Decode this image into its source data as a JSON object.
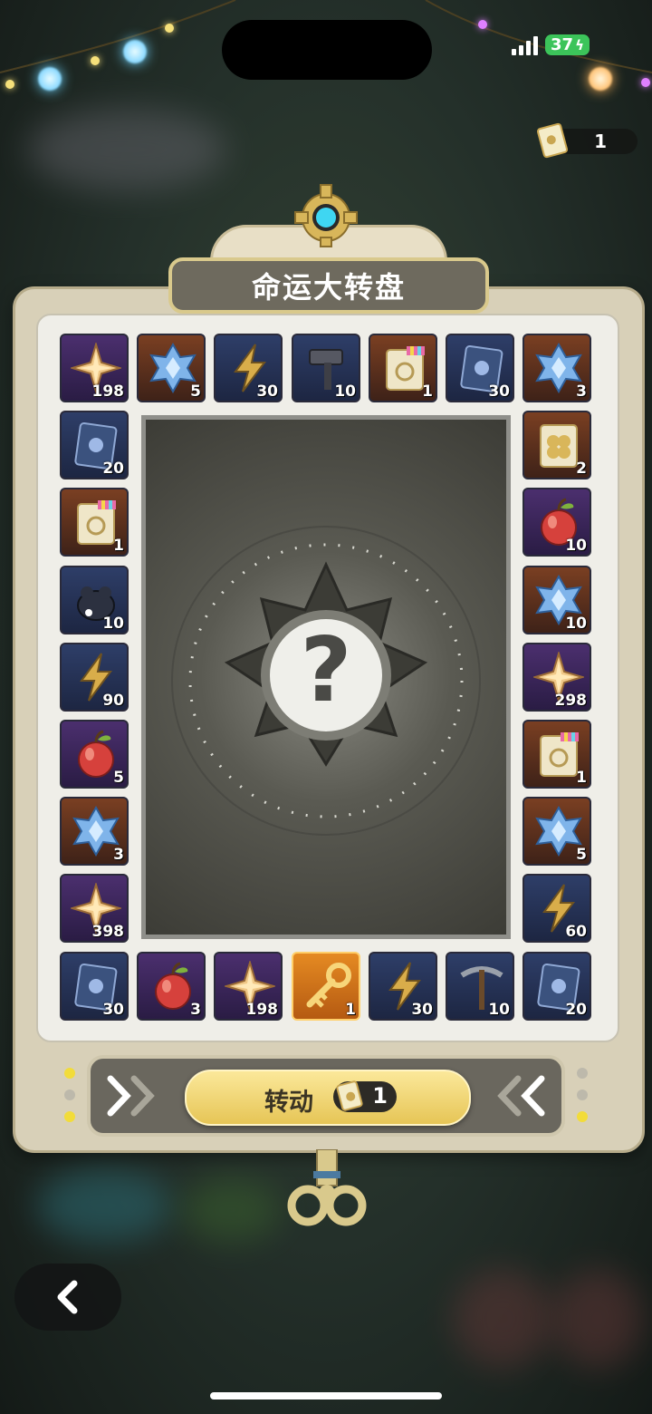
{
  "status_bar": {
    "battery": "37"
  },
  "ticket_balance": "1",
  "title": "命运大转盘",
  "center": {
    "mystery_symbol": "?"
  },
  "spin": {
    "label": "转动",
    "cost": "1"
  },
  "rewards": {
    "top": [
      {
        "item": "star-crystal-icon",
        "qty": "198",
        "rarity": "purple"
      },
      {
        "item": "blue-gem-icon",
        "qty": "5",
        "rarity": "orange"
      },
      {
        "item": "lightning-icon",
        "qty": "30",
        "rarity": "blue"
      },
      {
        "item": "hammer-icon",
        "qty": "10",
        "rarity": "blue"
      },
      {
        "item": "rainbow-ticket-icon",
        "qty": "1",
        "rarity": "orange"
      },
      {
        "item": "blue-card-icon",
        "qty": "30",
        "rarity": "blue"
      },
      {
        "item": "blue-gem-icon",
        "qty": "3",
        "rarity": "orange"
      }
    ],
    "left": [
      {
        "item": "blue-card-icon",
        "qty": "20",
        "rarity": "blue"
      },
      {
        "item": "rainbow-ticket-icon",
        "qty": "1",
        "rarity": "orange"
      },
      {
        "item": "dark-blob-icon",
        "qty": "10",
        "rarity": "blue"
      },
      {
        "item": "lightning-icon",
        "qty": "90",
        "rarity": "blue"
      },
      {
        "item": "apple-icon",
        "qty": "5",
        "rarity": "purple"
      },
      {
        "item": "blue-gem-icon",
        "qty": "3",
        "rarity": "orange"
      },
      {
        "item": "star-crystal-icon",
        "qty": "398",
        "rarity": "purple"
      }
    ],
    "right": [
      {
        "item": "clover-ticket-icon",
        "qty": "2",
        "rarity": "orange"
      },
      {
        "item": "apple-icon",
        "qty": "10",
        "rarity": "purple"
      },
      {
        "item": "blue-gem-icon",
        "qty": "10",
        "rarity": "orange"
      },
      {
        "item": "star-crystal-icon",
        "qty": "298",
        "rarity": "purple"
      },
      {
        "item": "rainbow-ticket-icon",
        "qty": "1",
        "rarity": "orange"
      },
      {
        "item": "blue-gem-icon",
        "qty": "5",
        "rarity": "orange"
      },
      {
        "item": "lightning-icon",
        "qty": "60",
        "rarity": "blue"
      }
    ],
    "bottom": [
      {
        "item": "blue-card-icon",
        "qty": "30",
        "rarity": "blue"
      },
      {
        "item": "apple-icon",
        "qty": "3",
        "rarity": "purple"
      },
      {
        "item": "star-crystal-icon",
        "qty": "198",
        "rarity": "purple"
      },
      {
        "item": "golden-key-icon",
        "qty": "1",
        "rarity": "gold"
      },
      {
        "item": "lightning-icon",
        "qty": "30",
        "rarity": "blue"
      },
      {
        "item": "pickaxe-icon",
        "qty": "10",
        "rarity": "blue"
      },
      {
        "item": "blue-card-icon",
        "qty": "20",
        "rarity": "blue"
      }
    ]
  },
  "colors": {
    "accent_gold": "#e6c556",
    "frame": "#d8d0b8",
    "indicator_on": "#f2dc3a",
    "indicator_off": "#bdb9ab"
  }
}
